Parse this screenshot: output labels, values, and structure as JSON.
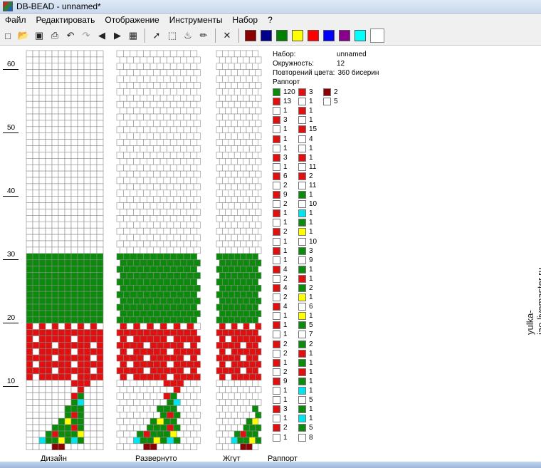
{
  "window": {
    "title": "DB-BEAD - unnamed*"
  },
  "menu": [
    "Файл",
    "Редактировать",
    "Отображение",
    "Инструменты",
    "Набор",
    "?"
  ],
  "toolbar": {
    "colors": [
      "#8b0000",
      "#00008b",
      "#008000",
      "#ffff00",
      "#ff0000",
      "#0000ff",
      "#8b008b",
      "#00ffff",
      "#ffffff"
    ],
    "icons": [
      "new-icon",
      "open-icon",
      "save-icon",
      "print-icon",
      "undo-icon",
      "redo-icon",
      "arrow-left-icon",
      "arrow-right-icon",
      "preview-icon",
      "pointer-icon",
      "select-icon",
      "fill-icon",
      "pipette-icon",
      "clear-icon"
    ]
  },
  "ruler": {
    "labels": [
      "60",
      "50",
      "40",
      "30",
      "20",
      "10"
    ]
  },
  "panels": {
    "design": "Дизайн",
    "unrolled": "Развернуто",
    "rope": "Жгут",
    "rapport": "Раппорт"
  },
  "info": {
    "set_label": "Набор:",
    "set_value": "unnamed",
    "circ_label": "Окружность:",
    "circ_value": "12",
    "rep_label": "Повторений цвета:",
    "rep_value": "360 бисерин",
    "rapport_label": "Раппорт"
  },
  "rapport": [
    [
      [
        "G",
        "120"
      ],
      [
        "R",
        "13"
      ],
      [
        "W",
        "1"
      ],
      [
        "R",
        "3"
      ],
      [
        "W",
        "1"
      ],
      [
        "R",
        "1"
      ],
      [
        "W",
        "1"
      ],
      [
        "R",
        "3"
      ],
      [
        "W",
        "1"
      ],
      [
        "R",
        "6"
      ],
      [
        "W",
        "2"
      ],
      [
        "R",
        "9"
      ],
      [
        "W",
        "2"
      ],
      [
        "R",
        "1"
      ],
      [
        "W",
        "1"
      ],
      [
        "R",
        "2"
      ],
      [
        "W",
        "1"
      ],
      [
        "R",
        "1"
      ],
      [
        "W",
        "1"
      ],
      [
        "R",
        "4"
      ],
      [
        "W",
        "2"
      ],
      [
        "R",
        "4"
      ],
      [
        "W",
        "2"
      ],
      [
        "R",
        "4"
      ],
      [
        "W",
        "1"
      ],
      [
        "R",
        "1"
      ],
      [
        "W",
        "1"
      ],
      [
        "R",
        "2"
      ],
      [
        "W",
        "2"
      ],
      [
        "R",
        "1"
      ],
      [
        "W",
        "2"
      ],
      [
        "R",
        "9"
      ],
      [
        "W",
        "1"
      ],
      [
        "W",
        "1"
      ],
      [
        "R",
        "3"
      ],
      [
        "W",
        "1"
      ],
      [
        "R",
        "2"
      ],
      [
        "W",
        "1"
      ]
    ],
    [
      [
        "R",
        "3"
      ],
      [
        "W",
        "1"
      ],
      [
        "R",
        "1"
      ],
      [
        "W",
        "1"
      ],
      [
        "R",
        "15"
      ],
      [
        "W",
        "4"
      ],
      [
        "W",
        "1"
      ],
      [
        "R",
        "1"
      ],
      [
        "W",
        "11"
      ],
      [
        "R",
        "2"
      ],
      [
        "W",
        "11"
      ],
      [
        "G",
        "1"
      ],
      [
        "W",
        "10"
      ],
      [
        "C",
        "1"
      ],
      [
        "G",
        "1"
      ],
      [
        "Y",
        "1"
      ],
      [
        "W",
        "10"
      ],
      [
        "G",
        "3"
      ],
      [
        "W",
        "9"
      ],
      [
        "G",
        "1"
      ],
      [
        "R",
        "1"
      ],
      [
        "G",
        "2"
      ],
      [
        "Y",
        "1"
      ],
      [
        "W",
        "6"
      ],
      [
        "Y",
        "1"
      ],
      [
        "G",
        "5"
      ],
      [
        "W",
        "7"
      ],
      [
        "G",
        "2"
      ],
      [
        "R",
        "1"
      ],
      [
        "G",
        "1"
      ],
      [
        "R",
        "1"
      ],
      [
        "G",
        "1"
      ],
      [
        "C",
        "1"
      ],
      [
        "W",
        "5"
      ],
      [
        "G",
        "1"
      ],
      [
        "C",
        "1"
      ],
      [
        "G",
        "5"
      ],
      [
        "W",
        "8"
      ]
    ],
    [
      [
        "D",
        "2"
      ],
      [
        "W",
        "5"
      ]
    ]
  ],
  "palette_map": {
    "G": "#0b8a0b",
    "R": "#e01010",
    "W": "#ffffff",
    "Y": "#ffff00",
    "C": "#00e5ee",
    "D": "#8b0000"
  },
  "watermark": "yulka-jao.livemaster.ru"
}
